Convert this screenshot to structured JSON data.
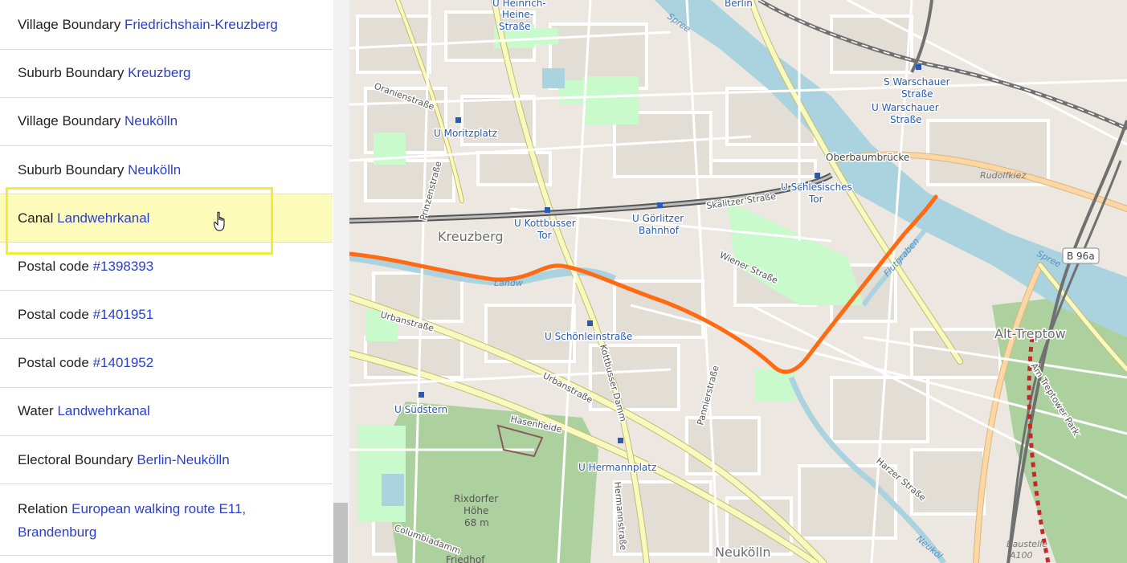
{
  "sidebar": {
    "rows": [
      {
        "type": "Village Boundary",
        "name": "Friedrichshain-Kreuzberg"
      },
      {
        "type": "Suburb Boundary",
        "name": "Kreuzberg"
      },
      {
        "type": "Village Boundary",
        "name": "Neukölln"
      },
      {
        "type": "Suburb Boundary",
        "name": "Neukölln"
      },
      {
        "type": "Canal",
        "name": "Landwehrkanal"
      },
      {
        "type": "Postal code",
        "name": "#1398393"
      },
      {
        "type": "Postal code",
        "name": "#1401951"
      },
      {
        "type": "Postal code",
        "name": "#1401952"
      },
      {
        "type": "Water",
        "name": "Landwehrkanal"
      },
      {
        "type": "Electoral Boundary",
        "name": "Berlin-Neukölln"
      },
      {
        "type": "Relation",
        "name": "European walking route E11, Brandenburg"
      }
    ]
  },
  "map": {
    "colors": {
      "background": "#ece8e1",
      "water": "#aad3df",
      "park": "#c8facc",
      "forest": "#add19e",
      "major_road": "#f7fabf",
      "highlight_route": "#ff6a13",
      "railway": "#707070",
      "label_station": "#2a5ab1"
    },
    "labels": {
      "heinrich_heine": [
        "U Heinrich-",
        "Heine-",
        "Straße"
      ],
      "berlin": "Berlin",
      "spree_top": "Spree",
      "warschauer_s": [
        "S Warschauer",
        "Straße"
      ],
      "warschauer_u": [
        "U Warschauer",
        "Straße"
      ],
      "oranienstrasse": "Oranienstraße",
      "moritzplatz": "U Moritzplatz",
      "oberbaumbruecke": "Oberbaumbrücke",
      "rudolfkiez": "Rudolfkiez",
      "prinzenstrasse": "Prinzenstraße",
      "skalitzer": "Skalitzer Straße",
      "schlesisches": [
        "U Schlesisches",
        "Tor"
      ],
      "kreuzberg": "Kreuzberg",
      "kottbusser": [
        "U Kottbusser",
        "Tor"
      ],
      "goerlitzer": [
        "U Görlitzer",
        "Bahnhof"
      ],
      "spree_right": "Spree",
      "b96a": "B 96a",
      "flutgraben": "Flutgraben",
      "wiener": "Wiener Straße",
      "landwehr": "Landw",
      "urbanstrasse_top": "Urbanstraße",
      "schoenlein": "U Schönleinstraße",
      "alt_treptow": "Alt-Treptow",
      "urbanstrasse_bottom": "Urbanstraße",
      "kottbusser_damm": "Kottbusser Damm",
      "pannierstrasse": "Pannierstraße",
      "suedstern": "U Südstern",
      "hasenheide": "Hasenheide",
      "treptower_park": "Am Treptower Park",
      "hermannplatz": "U Hermannplatz",
      "hermannstrasse": "Hermannstraße",
      "harzer": "Harzer Straße",
      "rixdorfer": [
        "Rixdorfer",
        "Höhe",
        "68 m"
      ],
      "columbiadamm": "Columbiadamm",
      "neukoelln": "Neukölln",
      "neukoelln_canal": "Neuköl",
      "baustelle": [
        "Baustelle",
        "A100"
      ],
      "friedhof": "Friedhof"
    }
  }
}
